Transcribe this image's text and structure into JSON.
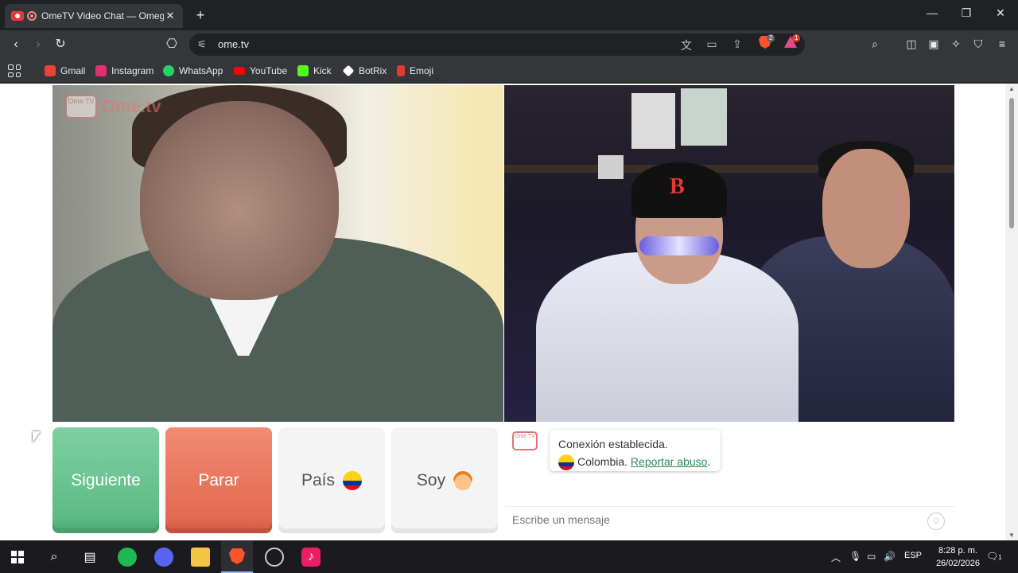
{
  "browser": {
    "tab_title": "OmeTV Video Chat — Omegl",
    "url": "ome.tv",
    "shields_count": "2",
    "rewards_count": "1"
  },
  "bookmarks": [
    {
      "label": "Gmail",
      "icon": "gmail-icon",
      "color": "#ea4335"
    },
    {
      "label": "Instagram",
      "icon": "instagram-icon",
      "color": "#e1306c"
    },
    {
      "label": "WhatsApp",
      "icon": "whatsapp-icon",
      "color": "#25d366"
    },
    {
      "label": "YouTube",
      "icon": "youtube-icon",
      "color": "#ff0000"
    },
    {
      "label": "Kick",
      "icon": "kick-icon",
      "color": "#53fc18"
    },
    {
      "label": "BotRix",
      "icon": "botrix-icon",
      "color": "#ffffff"
    },
    {
      "label": "Emoji",
      "icon": "emoji-icon",
      "color": "#e53935"
    }
  ],
  "ometv": {
    "logo_text": "Ome.tv",
    "logo_badge": "Ome TV",
    "buttons": {
      "next": "Siguiente",
      "stop": "Parar",
      "country": "País",
      "gender": "Soy"
    },
    "chat": {
      "status": "Conexión establecida.",
      "country": "Colombia.",
      "report_link": "Reportar abuso",
      "report_suffix": ".",
      "input_placeholder": "Escribe un mensaje"
    },
    "colors": {
      "next": "#5cbb85",
      "stop": "#e46a52",
      "link": "#2e8b57"
    }
  },
  "taskbar": {
    "lang": "ESP",
    "time": "8:28 p. m.",
    "date": "26/02/2026",
    "notifications": "1"
  }
}
